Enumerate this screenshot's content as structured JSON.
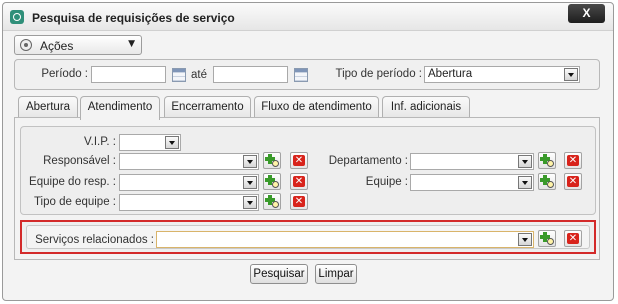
{
  "window": {
    "title": "Pesquisa de requisições de serviço",
    "close_label": "X",
    "app_icon": "app-logo-icon"
  },
  "actions": {
    "label": "Ações",
    "icon": "gear-icon"
  },
  "period": {
    "label": "Período :",
    "start_value": "",
    "until_label": "até",
    "end_value": "",
    "type_label": "Tipo de período :",
    "type_value": "Abertura"
  },
  "tabs": [
    {
      "label": "Abertura",
      "active": false
    },
    {
      "label": "Atendimento",
      "active": true
    },
    {
      "label": "Encerramento",
      "active": false
    },
    {
      "label": "Fluxo de atendimento",
      "active": false
    },
    {
      "label": "Inf. adicionais",
      "active": false
    }
  ],
  "fields": {
    "vip": {
      "label": "V.I.P. :",
      "value": ""
    },
    "responsavel": {
      "label": "Responsável :",
      "value": ""
    },
    "equipe_resp": {
      "label": "Equipe do resp. :",
      "value": ""
    },
    "tipo_equipe": {
      "label": "Tipo de equipe :",
      "value": ""
    },
    "departamento": {
      "label": "Departamento :",
      "value": ""
    },
    "equipe": {
      "label": "Equipe :",
      "value": ""
    },
    "servicos": {
      "label": "Serviços relacionados :",
      "value": ""
    }
  },
  "buttons": {
    "search": "Pesquisar",
    "clear": "Limpar"
  },
  "colors": {
    "highlight_border": "#d32a2a",
    "add_icon": "#3a9a2a",
    "delete_icon": "#d8231b"
  }
}
